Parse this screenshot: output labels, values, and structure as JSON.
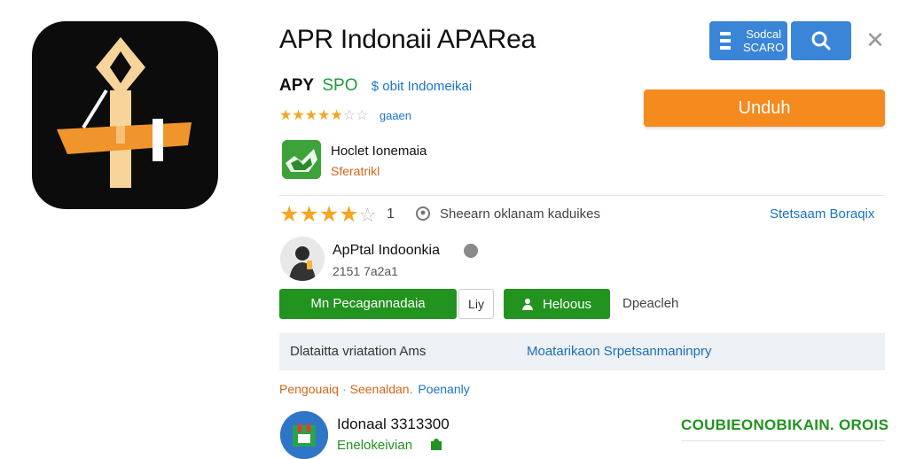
{
  "app": {
    "title": "APR Indonaii APARea",
    "developer_part1": "APY",
    "developer_part2": "SPO",
    "developer_link": "$ obit Indomeikai",
    "rating_link": "gaaen"
  },
  "header_buttons": {
    "badge_line1": "Sodcal",
    "badge_line2": "SCARO",
    "search_icon": "search-icon",
    "close_glyph": "✕"
  },
  "primary_action": {
    "label": "Unduh"
  },
  "secondary_app": {
    "title": "Hoclet Ionemaia",
    "subtitle": "Sferatrikl"
  },
  "ratings": {
    "stars_filled": 4,
    "stars_total": 5,
    "count": "1",
    "location_text": "Sheearn oklanam kaduikes",
    "side_link": "Stetsaam Boraqix"
  },
  "profile": {
    "name": "ApPtal Indoonkia",
    "sub": "2151 7a2a1"
  },
  "actions": {
    "main_label": "Mn Pecagannadaia",
    "small_label": "Liy",
    "green_label": "Heloous",
    "plain_label": "Dpeacleh"
  },
  "info_bar": {
    "left_text": "Dlataitta vriatation Ams",
    "right_text": "Moatarikaon Srpetsanmaninpry"
  },
  "tags": {
    "tag1": "Pengouaiq",
    "separator": "·",
    "tag2": "Seenaldan.",
    "tag3": "Poenanly"
  },
  "bottom": {
    "title": "Idonaal 3313300",
    "subtitle": "Enelokeivian",
    "right_text": "COUBIEONOBIKAIN. OROIS"
  },
  "colors": {
    "blue_button": "#3b85d8",
    "orange_button": "#f58a1f",
    "green_button": "#22931f",
    "link_blue": "#1a73c8",
    "star": "#f5a623"
  }
}
